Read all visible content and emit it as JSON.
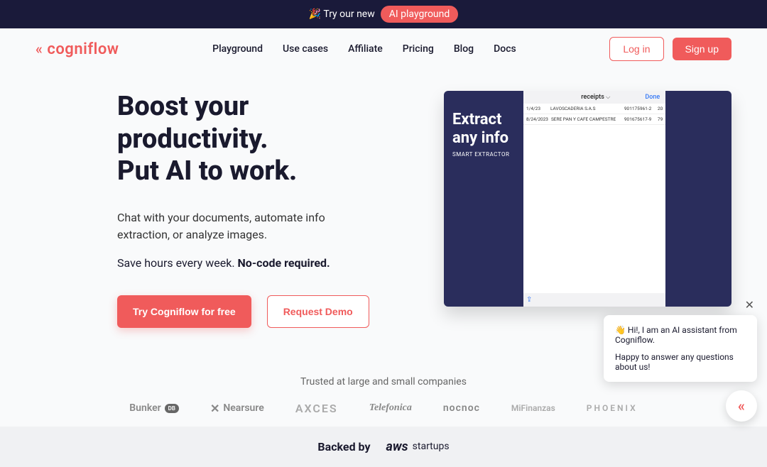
{
  "banner": {
    "pre_text": "🎉 Try our new",
    "pill_text": "AI playground"
  },
  "brand": {
    "name": "cogniflow",
    "icon": "«"
  },
  "nav": {
    "items": [
      "Playground",
      "Use cases",
      "Affiliate",
      "Pricing",
      "Blog",
      "Docs"
    ]
  },
  "auth": {
    "login": "Log in",
    "signup": "Sign up"
  },
  "hero": {
    "heading_line1": "Boost your productivity.",
    "heading_line2": "Put AI to work.",
    "sub1": "Chat with your documents, automate info extraction, or analyze images.",
    "sub2_pre": "Save hours every week. ",
    "sub2_bold": "No-code required.",
    "cta_primary": "Try Cogniflow for free",
    "cta_secondary": "Request Demo"
  },
  "demo": {
    "extract_title": "Extract any info",
    "extract_sub": "SMART EXTRACTOR",
    "pane_title": "receipts",
    "done": "Done",
    "rows": [
      {
        "date": "1/4/23",
        "vendor": "LAVOSCADERIA S.A.S",
        "id": "901175961-2",
        "amt": "20"
      },
      {
        "date": "8/24/2023",
        "vendor": "SERE PAN Y CAFE CAMPESTRE",
        "id": "901675617-9",
        "amt": "79"
      }
    ],
    "share_icon": "⇪"
  },
  "trusted": {
    "label": "Trusted at large and small companies",
    "logos": [
      "Bunker",
      "Nearsure",
      "AXCES",
      "Telefonica",
      "nocnoc",
      "MiFinanzas",
      "PHOENIX"
    ]
  },
  "backed": {
    "label": "Backed by",
    "aws": "aws",
    "startups": "startups"
  },
  "chat": {
    "line1": "👋 Hi!, I am an AI assistant from Cogniflow.",
    "line2": "Happy to answer any questions about us!",
    "close": "✕"
  }
}
